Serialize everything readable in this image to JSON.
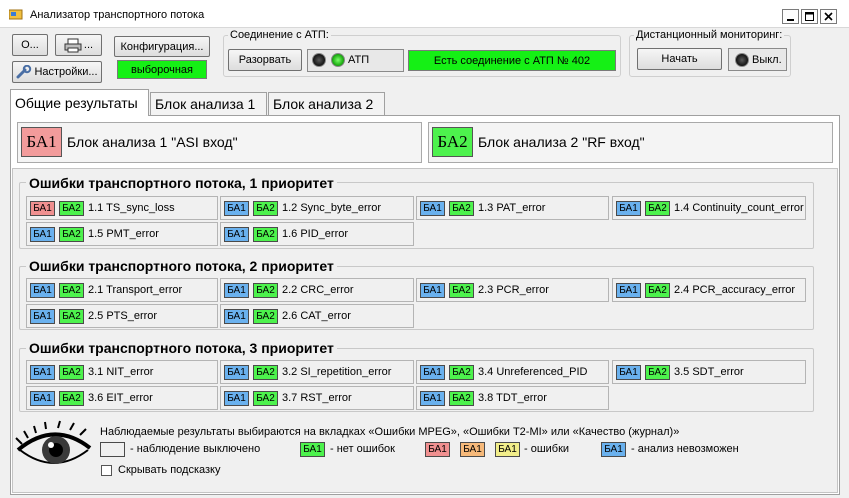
{
  "window": {
    "title": "Анализатор транспортного потока",
    "controls": [
      "_",
      "□",
      "X"
    ]
  },
  "toolbar": {
    "about_label": "О...",
    "print_label": "...",
    "settings_label": "Настройки...",
    "config_label": "Конфигурация...",
    "config_status": "выборочная"
  },
  "connection": {
    "group_label": "Соединение с АТП:",
    "disconnect_label": "Разорвать",
    "atp_label": "АТП",
    "status_text": "Есть соединение с АТП № 402"
  },
  "monitoring": {
    "group_label": "Дистанционный мониторинг:",
    "start_label": "Начать",
    "state_label": "Выкл."
  },
  "tabs": [
    {
      "label": "Общие результаты",
      "active": true
    },
    {
      "label": "Блок анализа 1",
      "active": false
    },
    {
      "label": "Блок анализа 2",
      "active": false
    }
  ],
  "analysis_blocks": [
    {
      "badge": "БА1",
      "label": "Блок анализа 1 \"ASI вход\"",
      "color": "#f29b9b"
    },
    {
      "badge": "БА2",
      "label": "Блок анализа 2 \"RF вход\"",
      "color": "#4df24d"
    }
  ],
  "badge_labels": {
    "ba1": "БА1",
    "ba2": "БА2"
  },
  "sections": [
    {
      "title": "Ошибки транспортного потока, 1 приоритет",
      "items": [
        {
          "label": "1.1 TS_sync_loss",
          "ba1": "red",
          "ba2": "green"
        },
        {
          "label": "1.2 Sync_byte_error",
          "ba1": "blue",
          "ba2": "green"
        },
        {
          "label": "1.3 PAT_error",
          "ba1": "blue",
          "ba2": "green"
        },
        {
          "label": "1.4 Continuity_count_error",
          "ba1": "blue",
          "ba2": "green"
        },
        {
          "label": "1.5 PMT_error",
          "ba1": "blue",
          "ba2": "green"
        },
        {
          "label": "1.6 PID_error",
          "ba1": "blue",
          "ba2": "green"
        }
      ]
    },
    {
      "title": "Ошибки транспортного потока, 2 приоритет",
      "items": [
        {
          "label": "2.1 Transport_error",
          "ba1": "blue",
          "ba2": "green"
        },
        {
          "label": "2.2 CRC_error",
          "ba1": "blue",
          "ba2": "green"
        },
        {
          "label": "2.3 PCR_error",
          "ba1": "blue",
          "ba2": "green"
        },
        {
          "label": "2.4 PCR_accuracy_error",
          "ba1": "blue",
          "ba2": "green"
        },
        {
          "label": "2.5 PTS_error",
          "ba1": "blue",
          "ba2": "green"
        },
        {
          "label": "2.6 CAT_error",
          "ba1": "blue",
          "ba2": "green"
        }
      ]
    },
    {
      "title": "Ошибки транспортного потока, 3 приоритет",
      "items": [
        {
          "label": "3.1 NIT_error",
          "ba1": "blue",
          "ba2": "green"
        },
        {
          "label": "3.2 SI_repetition_error",
          "ba1": "blue",
          "ba2": "green"
        },
        {
          "label": "3.4 Unreferenced_PID",
          "ba1": "blue",
          "ba2": "green"
        },
        {
          "label": "3.5 SDT_error",
          "ba1": "blue",
          "ba2": "green"
        },
        {
          "label": "3.6 EIT_error",
          "ba1": "blue",
          "ba2": "green"
        },
        {
          "label": "3.7 RST_error",
          "ba1": "blue",
          "ba2": "green"
        },
        {
          "label": "3.8 TDT_error",
          "ba1": "blue",
          "ba2": "green"
        }
      ]
    }
  ],
  "legend": {
    "hint": "Наблюдаемые результаты выбираются на вкладках «Ошибки MPEG», «Ошибки T2-MI» или «Качество (журнал)»",
    "off_text": "- наблюдение выключено",
    "ok_badge": "БА1",
    "ok_text": "- нет ошибок",
    "err_badges": [
      "БА1",
      "БА1",
      "БА1"
    ],
    "err_text": "- ошибки",
    "na_badge": "БА1",
    "na_text": "- анализ невозможен",
    "hide_hint_label": "Скрывать подсказку"
  },
  "colors": {
    "badge_blue": "#6ab1ee",
    "badge_green": "#4df24d",
    "badge_red": "#f09090",
    "badge_orange": "#f6b97a",
    "badge_yellow": "#f2ee8a",
    "status_green": "#15f015"
  },
  "icons": [
    "app-icon",
    "printer-icon",
    "wrench-icon",
    "led-icon",
    "eye-icon"
  ]
}
